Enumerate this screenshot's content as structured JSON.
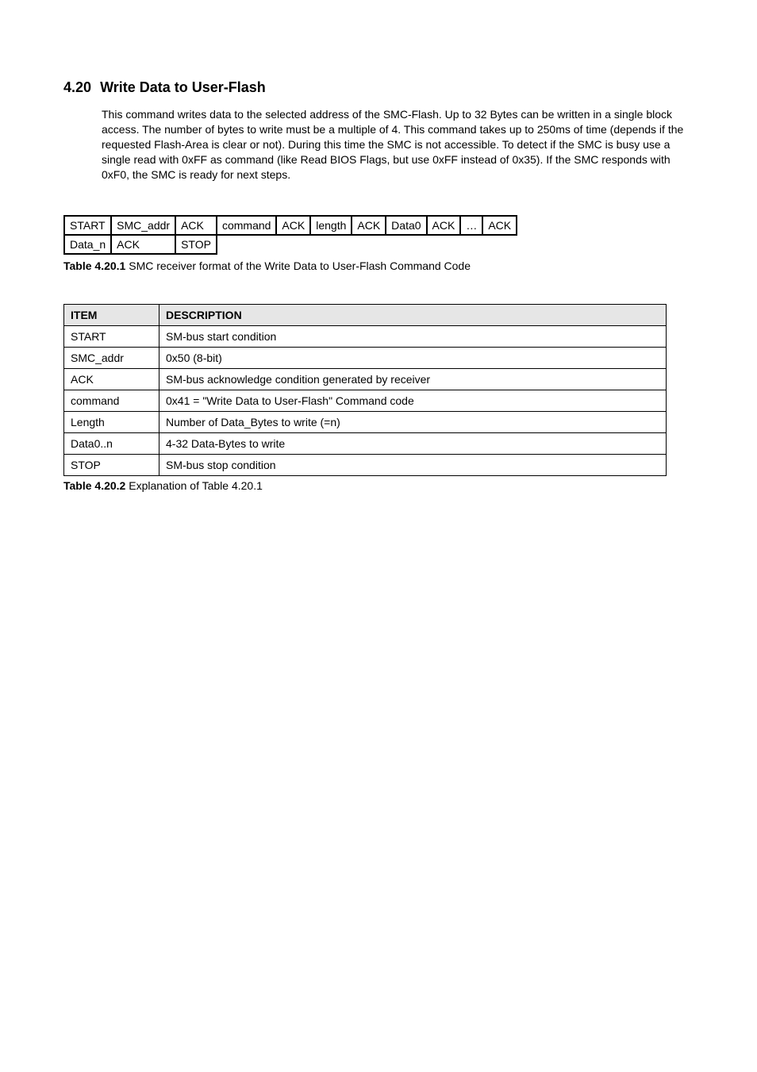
{
  "heading": {
    "number": "4.20",
    "title": "Write Data to User-Flash"
  },
  "body_paragraph": "This command writes data to the selected address of the SMC-Flash. Up to 32 Bytes can be written in a single block access. The number of bytes to write must be a multiple of 4. This command takes up to 250ms of time (depends if the requested Flash-Area is clear or not). During this time the SMC is not accessible. To detect if the SMC is busy use a single read with 0xFF as command (like Read BIOS Flags, but use 0xFF instead of 0x35). If the SMC responds with 0xF0, the SMC is ready for next steps.",
  "sequence_table": {
    "rows": [
      [
        "START",
        "SMC_addr",
        "ACK",
        "command",
        "ACK",
        "length",
        "ACK",
        "Data0",
        "ACK",
        "…",
        "ACK"
      ],
      [
        "Data_n",
        "ACK",
        "STOP"
      ]
    ]
  },
  "caption1": {
    "label": "Table 4.20.1",
    "text": "SMC receiver format of the Write Data to User-Flash Command Code"
  },
  "description_table": {
    "headers": [
      "ITEM",
      "DESCRIPTION"
    ],
    "rows": [
      [
        "START",
        "SM-bus start condition"
      ],
      [
        "SMC_addr",
        "0x50 (8-bit)"
      ],
      [
        "ACK",
        "SM-bus acknowledge condition generated by receiver"
      ],
      [
        "command",
        "0x41 = \"Write Data to User-Flash\" Command code"
      ],
      [
        "Length",
        "Number of Data_Bytes to write (=n)"
      ],
      [
        "Data0..n",
        "4-32 Data-Bytes to write"
      ],
      [
        "STOP",
        "SM-bus stop condition"
      ]
    ]
  },
  "caption2": {
    "label": "Table 4.20.2",
    "text": "Explanation of Table 4.20.1"
  }
}
